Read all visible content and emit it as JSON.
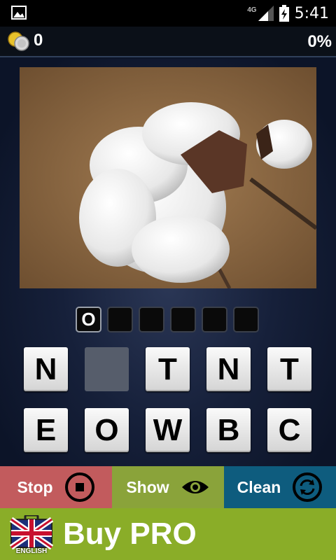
{
  "status_bar": {
    "network_type": "4G",
    "time": "5:41"
  },
  "top_bar": {
    "coins": "0",
    "progress": "0%"
  },
  "puzzle": {
    "answer_slots": [
      "O",
      "",
      "",
      "",
      "",
      ""
    ],
    "letter_tiles": [
      [
        "N",
        "",
        "T",
        "N",
        "T"
      ],
      [
        "E",
        "O",
        "W",
        "B",
        "C"
      ]
    ]
  },
  "actions": {
    "stop_label": "Stop",
    "show_label": "Show",
    "clean_label": "Clean"
  },
  "promo": {
    "language_label": "ENGLISH",
    "buy_label": "Buy PRO"
  },
  "colors": {
    "stop": "#c25b5d",
    "show": "#8aa33a",
    "clean": "#0e5c7e",
    "promo": "#8aad28"
  },
  "icons": {
    "status_left": "image-icon",
    "signal": "signal-icon",
    "battery": "battery-charging-icon",
    "coins": "coins-icon",
    "stop": "stop-circle-icon",
    "show": "eye-icon",
    "clean": "refresh-icon",
    "language": "uk-flag-icon"
  }
}
